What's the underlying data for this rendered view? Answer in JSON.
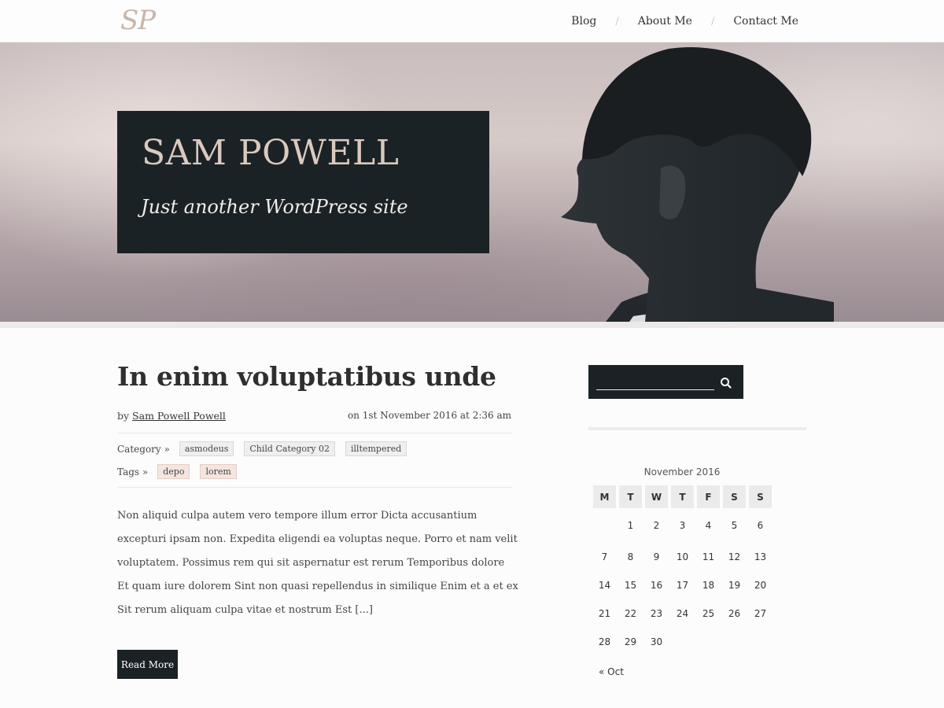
{
  "header": {
    "logo": "SP",
    "nav": [
      {
        "label": "Blog"
      },
      {
        "label": "About Me"
      },
      {
        "label": "Contact Me"
      }
    ],
    "separator": "/"
  },
  "hero": {
    "title": "SAM POWELL",
    "tagline": "Just another WordPress site"
  },
  "post": {
    "title": "In enim voluptatibus unde",
    "by_prefix": "by ",
    "author": "Sam Powell Powell",
    "date": "on 1st November 2016 at 2:36 am",
    "category_label": "Category »",
    "categories": [
      "asmodeus",
      "Child Category 02",
      "illtempered"
    ],
    "tags_label": "Tags »",
    "tags": [
      "depo",
      "lorem"
    ],
    "excerpt": "Non aliquid culpa autem vero tempore illum error Dicta accusantium excepturi ipsam non. Expedita eligendi ea voluptas neque. Porro et nam velit voluptatem. Possimus rem qui sit aspernatur est rerum Temporibus dolore Et quam iure dolorem Sint non quasi repellendus in similique Enim et a et ex Sit rerum aliquam culpa vitae et nostrum Est [...]",
    "read_more": "Read More"
  },
  "sidebar": {
    "search": {
      "value": "",
      "placeholder": ""
    },
    "calendar": {
      "caption": "November 2016",
      "weekdays": [
        "M",
        "T",
        "W",
        "T",
        "F",
        "S",
        "S"
      ],
      "weeks": [
        [
          "",
          "1",
          "2",
          "3",
          "4",
          "5",
          "6"
        ],
        [
          "7",
          "8",
          "9",
          "10",
          "11",
          "12",
          "13"
        ],
        [
          "14",
          "15",
          "16",
          "17",
          "18",
          "19",
          "20"
        ],
        [
          "21",
          "22",
          "23",
          "24",
          "25",
          "26",
          "27"
        ],
        [
          "28",
          "29",
          "30",
          "",
          "",
          "",
          ""
        ]
      ],
      "prev": "« Oct"
    }
  },
  "colors": {
    "dark": "#1b2226",
    "logo": "#c9b4a8",
    "title_text": "#dac9bd"
  }
}
